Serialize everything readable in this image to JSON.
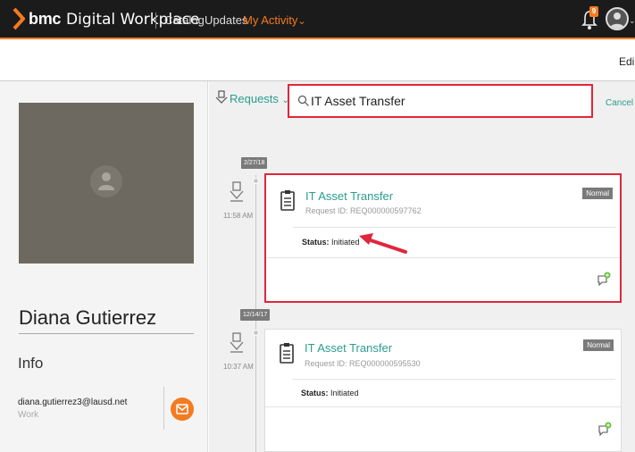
{
  "app": {
    "brand": "bmc",
    "brand_product": "Digital Workplace",
    "nav": [
      "Catalog",
      "Updates",
      "My Activity"
    ],
    "nav_active_suffix": "⌄",
    "notification_count": "9",
    "edit_label": "Edi"
  },
  "profile": {
    "name": "Diana Gutierrez",
    "info_heading": "Info",
    "email": "diana.gutierrez3@lausd.net",
    "email_type": "Work"
  },
  "feed": {
    "requests_label": "Requests",
    "search_value": "IT Asset Transfer",
    "cancel_label": "Cancel",
    "items": [
      {
        "date": "2/27/18",
        "time": "11:58 AM",
        "title": "IT Asset Transfer",
        "request_id": "Request ID: REQ000000597762",
        "status_label": "Status:",
        "status_value": "Initiated",
        "priority": "Normal",
        "highlighted": true
      },
      {
        "date": "12/14/17",
        "time": "10:37 AM",
        "title": "IT Asset Transfer",
        "request_id": "Request ID: REQ000000595530",
        "status_label": "Status:",
        "status_value": "Initiated",
        "priority": "Normal",
        "highlighted": false
      }
    ]
  },
  "colors": {
    "accent": "#f47b20",
    "teal": "#2a9d8f",
    "highlight": "#e0263b",
    "topbar": "#1b1b1b"
  },
  "icons": [
    "bmc-chevron-logo",
    "bell-icon",
    "user-avatar-icon",
    "requests-icon",
    "search-icon",
    "clipboard-icon",
    "comment-add-icon",
    "mail-icon",
    "person-silhouette-icon",
    "annotation-arrow"
  ]
}
